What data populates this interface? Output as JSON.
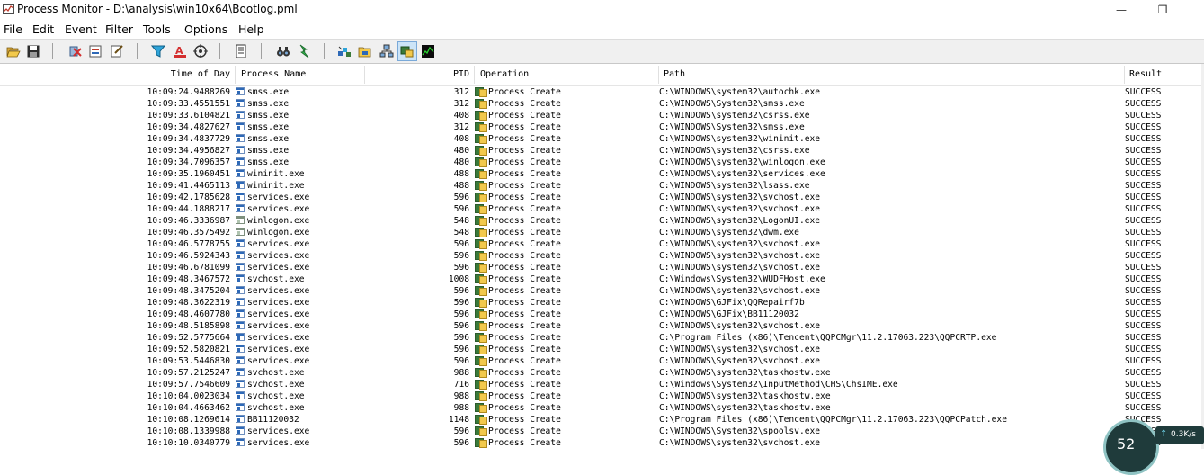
{
  "window": {
    "title": "Process Monitor - D:\\analysis\\win10x64\\Bootlog.pml",
    "minimize_glyph": "—",
    "restore_glyph": "❐"
  },
  "menu": [
    "File",
    "Edit",
    "Event",
    "Filter",
    "Tools",
    "Options",
    "Help"
  ],
  "toolbar": {
    "buttons": [
      "open-icon",
      "save-icon",
      "capture-icon",
      "autoscroll-icon",
      "clear-icon",
      "filter-icon",
      "highlight-icon",
      "target-icon",
      "tree-icon",
      "find-icon",
      "jump-icon",
      "registry-icon",
      "filesystem-icon",
      "network-icon",
      "process-activity-icon",
      "profiling-icon"
    ]
  },
  "columns": {
    "time": "Time of Day",
    "process": "Process Name",
    "pid": "PID",
    "operation": "Operation",
    "path": "Path",
    "result": "Result"
  },
  "rows": [
    {
      "time": "10:09:24.9488269",
      "process": "smss.exe",
      "pid": "312",
      "operation": "Process Create",
      "path": "C:\\WINDOWS\\system32\\autochk.exe",
      "result": "SUCCESS"
    },
    {
      "time": "10:09:33.4551551",
      "process": "smss.exe",
      "pid": "312",
      "operation": "Process Create",
      "path": "C:\\WINDOWS\\System32\\smss.exe",
      "result": "SUCCESS"
    },
    {
      "time": "10:09:33.6104821",
      "process": "smss.exe",
      "pid": "408",
      "operation": "Process Create",
      "path": "C:\\WINDOWS\\system32\\csrss.exe",
      "result": "SUCCESS"
    },
    {
      "time": "10:09:34.4827627",
      "process": "smss.exe",
      "pid": "312",
      "operation": "Process Create",
      "path": "C:\\WINDOWS\\System32\\smss.exe",
      "result": "SUCCESS"
    },
    {
      "time": "10:09:34.4837729",
      "process": "smss.exe",
      "pid": "408",
      "operation": "Process Create",
      "path": "C:\\WINDOWS\\system32\\wininit.exe",
      "result": "SUCCESS"
    },
    {
      "time": "10:09:34.4956827",
      "process": "smss.exe",
      "pid": "480",
      "operation": "Process Create",
      "path": "C:\\WINDOWS\\system32\\csrss.exe",
      "result": "SUCCESS"
    },
    {
      "time": "10:09:34.7096357",
      "process": "smss.exe",
      "pid": "480",
      "operation": "Process Create",
      "path": "C:\\WINDOWS\\system32\\winlogon.exe",
      "result": "SUCCESS"
    },
    {
      "time": "10:09:35.1960451",
      "process": "wininit.exe",
      "pid": "488",
      "operation": "Process Create",
      "path": "C:\\WINDOWS\\system32\\services.exe",
      "result": "SUCCESS"
    },
    {
      "time": "10:09:41.4465113",
      "process": "wininit.exe",
      "pid": "488",
      "operation": "Process Create",
      "path": "C:\\WINDOWS\\system32\\lsass.exe",
      "result": "SUCCESS"
    },
    {
      "time": "10:09:42.1785628",
      "process": "services.exe",
      "pid": "596",
      "operation": "Process Create",
      "path": "C:\\WINDOWS\\system32\\svchost.exe",
      "result": "SUCCESS"
    },
    {
      "time": "10:09:44.1888217",
      "process": "services.exe",
      "pid": "596",
      "operation": "Process Create",
      "path": "C:\\WINDOWS\\system32\\svchost.exe",
      "result": "SUCCESS"
    },
    {
      "time": "10:09:46.3336987",
      "process": "winlogon.exe",
      "pid": "548",
      "operation": "Process Create",
      "path": "C:\\WINDOWS\\system32\\LogonUI.exe",
      "result": "SUCCESS"
    },
    {
      "time": "10:09:46.3575492",
      "process": "winlogon.exe",
      "pid": "548",
      "operation": "Process Create",
      "path": "C:\\WINDOWS\\system32\\dwm.exe",
      "result": "SUCCESS"
    },
    {
      "time": "10:09:46.5778755",
      "process": "services.exe",
      "pid": "596",
      "operation": "Process Create",
      "path": "C:\\WINDOWS\\system32\\svchost.exe",
      "result": "SUCCESS"
    },
    {
      "time": "10:09:46.5924343",
      "process": "services.exe",
      "pid": "596",
      "operation": "Process Create",
      "path": "C:\\WINDOWS\\system32\\svchost.exe",
      "result": "SUCCESS"
    },
    {
      "time": "10:09:46.6781099",
      "process": "services.exe",
      "pid": "596",
      "operation": "Process Create",
      "path": "C:\\WINDOWS\\system32\\svchost.exe",
      "result": "SUCCESS"
    },
    {
      "time": "10:09:48.3467572",
      "process": "svchost.exe",
      "pid": "1008",
      "operation": "Process Create",
      "path": "C:\\Windows\\System32\\WUDFHost.exe",
      "result": "SUCCESS"
    },
    {
      "time": "10:09:48.3475204",
      "process": "services.exe",
      "pid": "596",
      "operation": "Process Create",
      "path": "C:\\WINDOWS\\system32\\svchost.exe",
      "result": "SUCCESS"
    },
    {
      "time": "10:09:48.3622319",
      "process": "services.exe",
      "pid": "596",
      "operation": "Process Create",
      "path": "C:\\WINDOWS\\GJFix\\QQRepairf7b",
      "result": "SUCCESS"
    },
    {
      "time": "10:09:48.4607780",
      "process": "services.exe",
      "pid": "596",
      "operation": "Process Create",
      "path": "C:\\WINDOWS\\GJFix\\BB11120032",
      "result": "SUCCESS"
    },
    {
      "time": "10:09:48.5185898",
      "process": "services.exe",
      "pid": "596",
      "operation": "Process Create",
      "path": "C:\\WINDOWS\\system32\\svchost.exe",
      "result": "SUCCESS"
    },
    {
      "time": "10:09:52.5775664",
      "process": "services.exe",
      "pid": "596",
      "operation": "Process Create",
      "path": "C:\\Program Files (x86)\\Tencent\\QQPCMgr\\11.2.17063.223\\QQPCRTP.exe",
      "result": "SUCCESS"
    },
    {
      "time": "10:09:52.5820821",
      "process": "services.exe",
      "pid": "596",
      "operation": "Process Create",
      "path": "C:\\WINDOWS\\system32\\svchost.exe",
      "result": "SUCCESS"
    },
    {
      "time": "10:09:53.5446830",
      "process": "services.exe",
      "pid": "596",
      "operation": "Process Create",
      "path": "C:\\WINDOWS\\System32\\svchost.exe",
      "result": "SUCCESS"
    },
    {
      "time": "10:09:57.2125247",
      "process": "svchost.exe",
      "pid": "988",
      "operation": "Process Create",
      "path": "C:\\WINDOWS\\system32\\taskhostw.exe",
      "result": "SUCCESS"
    },
    {
      "time": "10:09:57.7546609",
      "process": "svchost.exe",
      "pid": "716",
      "operation": "Process Create",
      "path": "C:\\Windows\\System32\\InputMethod\\CHS\\ChsIME.exe",
      "result": "SUCCESS"
    },
    {
      "time": "10:10:04.0023034",
      "process": "svchost.exe",
      "pid": "988",
      "operation": "Process Create",
      "path": "C:\\WINDOWS\\system32\\taskhostw.exe",
      "result": "SUCCESS"
    },
    {
      "time": "10:10:04.4663462",
      "process": "svchost.exe",
      "pid": "988",
      "operation": "Process Create",
      "path": "C:\\WINDOWS\\system32\\taskhostw.exe",
      "result": "SUCCESS"
    },
    {
      "time": "10:10:08.1269614",
      "process": "BB11120032",
      "pid": "1148",
      "operation": "Process Create",
      "path": "C:\\Program Files (x86)\\Tencent\\QQPCMgr\\11.2.17063.223\\QQPCPatch.exe",
      "result": "SUCCESS"
    },
    {
      "time": "10:10:08.1339988",
      "process": "services.exe",
      "pid": "596",
      "operation": "Process Create",
      "path": "C:\\WINDOWS\\System32\\spoolsv.exe",
      "result": "SUCCESS"
    },
    {
      "time": "10:10:10.0340779",
      "process": "services.exe",
      "pid": "596",
      "operation": "Process Create",
      "path": "C:\\WINDOWS\\system32\\svchost.exe",
      "result": "SUCCESS"
    }
  ],
  "network_widget": {
    "percent": "52",
    "upload": "0.3K/s"
  }
}
